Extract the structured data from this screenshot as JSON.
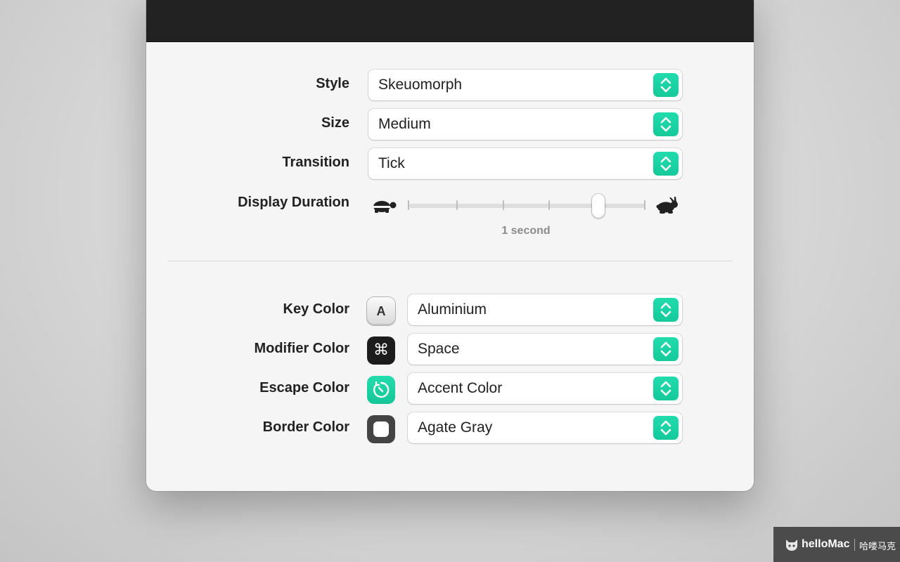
{
  "settings": {
    "style": {
      "label": "Style",
      "value": "Skeuomorph"
    },
    "size": {
      "label": "Size",
      "value": "Medium"
    },
    "transition": {
      "label": "Transition",
      "value": "Tick"
    },
    "display_duration": {
      "label": "Display Duration",
      "caption": "1 second",
      "level": 0.8
    }
  },
  "colors": {
    "key": {
      "label": "Key Color",
      "value": "Aluminium",
      "swatch_glyph": "A"
    },
    "modifier": {
      "label": "Modifier Color",
      "value": "Space",
      "swatch_glyph": "⌘"
    },
    "escape": {
      "label": "Escape Color",
      "value": "Accent Color"
    },
    "border": {
      "label": "Border Color",
      "value": "Agate Gray"
    }
  },
  "accent_color": "#1fd6a6",
  "watermark": {
    "brand": "helloMac",
    "cn": "哈喽马克"
  }
}
